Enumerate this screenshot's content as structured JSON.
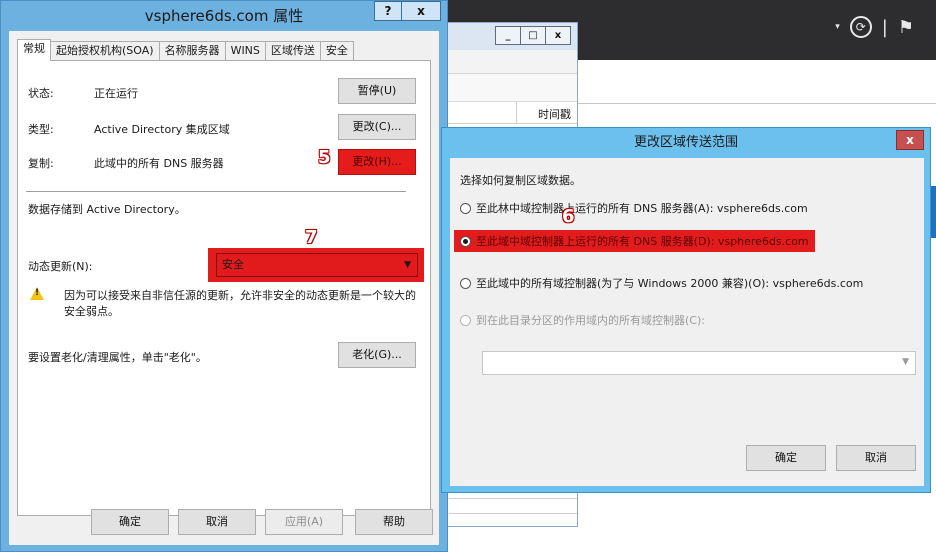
{
  "main_dialog": {
    "title": "vsphere6ds.com 属性",
    "help_btn": "?",
    "close_btn": "x",
    "tabs": [
      "常规",
      "起始授权机构(SOA)",
      "名称服务器",
      "WINS",
      "区域传送",
      "安全"
    ],
    "status_label": "状态:",
    "status_value": "正在运行",
    "pause_btn": "暂停(U)",
    "type_label": "类型:",
    "type_value": "Active Directory 集成区域",
    "change_type_btn": "更改(C)...",
    "replication_label": "复制:",
    "replication_value": "此域中的所有 DNS 服务器",
    "change_replication_btn": "更改(H)...",
    "stored_text": "数据存储到 Active Directory。",
    "dynamic_update_label": "动态更新(N):",
    "dynamic_update_value": "安全",
    "warning_line1": "因为可以接受来自非信任源的更新，允许非安全的动态更新是一个较大的",
    "warning_line2": "安全弱点。",
    "aging_text": "要设置老化/清理属性，单击\"老化\"。",
    "aging_btn": "老化(G)...",
    "ok_btn": "确定",
    "cancel_btn": "取消",
    "apply_btn": "应用(A)",
    "help_bottom_btn": "帮助"
  },
  "background_window": {
    "min_btn": "_",
    "max_btn": "□",
    "close_btn": "x",
    "column_header": "时间戳"
  },
  "zone_dialog": {
    "title": "更改区域传送范围",
    "close_btn": "x",
    "prompt": "选择如何复制区域数据。",
    "options": [
      "至此林中域控制器上运行的所有 DNS 服务器(A): vsphere6ds.com",
      "至此域中域控制器上运行的所有 DNS 服务器(D): vsphere6ds.com",
      "至此域中的所有域控制器(为了与 Windows 2000 兼容)(O): vsphere6ds.com",
      "到在此目录分区的作用域内的所有域控制器(C):"
    ],
    "ok_btn": "确定",
    "cancel_btn": "取消"
  },
  "annotations": {
    "step5": "5",
    "step6": "6",
    "step7": "7"
  },
  "icons": {
    "warning": "warning-icon",
    "refresh": "refresh-icon",
    "flag": "flag-icon"
  },
  "colors": {
    "highlight_red": "#e21c1c",
    "title_blue": "#6cb1e0"
  }
}
